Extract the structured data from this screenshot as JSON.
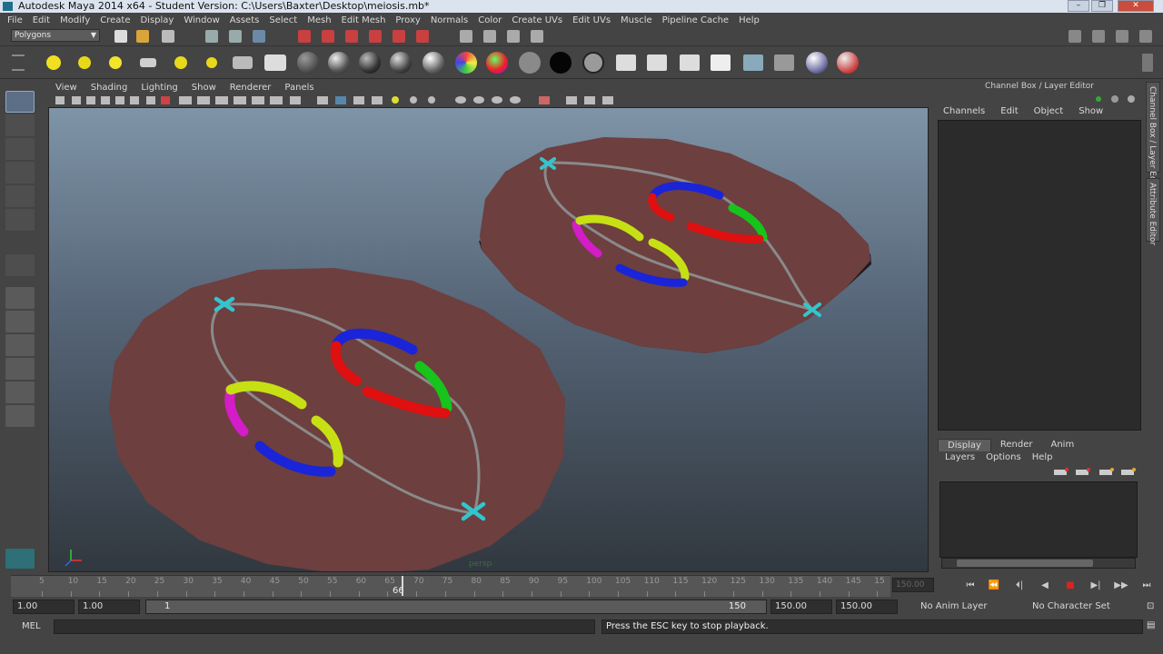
{
  "window": {
    "title": "Autodesk Maya 2014 x64 - Student Version: C:\\Users\\Baxter\\Desktop\\meiosis.mb*",
    "controls": [
      "–",
      "❐",
      "✕"
    ]
  },
  "menus": [
    "File",
    "Edit",
    "Modify",
    "Create",
    "Display",
    "Window",
    "Assets",
    "Select",
    "Mesh",
    "Edit Mesh",
    "Proxy",
    "Normals",
    "Color",
    "Create UVs",
    "Edit UVs",
    "Muscle",
    "Pipeline Cache",
    "Help"
  ],
  "statusline": {
    "mode_menu": "Polygons"
  },
  "panel": {
    "menus": [
      "View",
      "Shading",
      "Lighting",
      "Show",
      "Renderer",
      "Panels"
    ],
    "camera_label": "persp"
  },
  "colors": {
    "disc_top": "#6d3f3f",
    "disc_side": "#1a1a1f",
    "spindle": "#8a8a8a",
    "centriole": "#33c5cc",
    "red": "#e01010",
    "blue": "#1a24d8",
    "green": "#16c41c",
    "magenta": "#d41cc8",
    "yellow_green": "#c6e014"
  },
  "channel_box": {
    "title": "Channel Box / Layer Editor",
    "menus": [
      "Channels",
      "Edit",
      "Object",
      "Show"
    ],
    "side_tabs": [
      "Channel Box / Layer Editor",
      "Attribute Editor"
    ]
  },
  "layer_editor": {
    "tabs": [
      "Display",
      "Render",
      "Anim"
    ],
    "active_tab": "Display",
    "menus": [
      "Layers",
      "Options",
      "Help"
    ]
  },
  "time_slider": {
    "ticks": [
      "5",
      "10",
      "15",
      "20",
      "25",
      "30",
      "35",
      "40",
      "45",
      "50",
      "55",
      "60",
      "65",
      "70",
      "75",
      "80",
      "85",
      "90",
      "95",
      "100",
      "105",
      "110",
      "115",
      "120",
      "125",
      "130",
      "135",
      "140",
      "145",
      "15"
    ],
    "current_frame": "66",
    "current_time_field": "150.00",
    "playback_buttons": [
      "⏮",
      "⏪",
      "⏴|",
      "◀",
      "■",
      "▶|",
      "▶▶",
      "⏭"
    ]
  },
  "range": {
    "start_time": "1.00",
    "playback_start": "1.00",
    "slider_start": "1",
    "slider_end": "150",
    "playback_end": "150.00",
    "end_time": "150.00",
    "anim_layer": "No Anim Layer",
    "character_set": "No Character Set"
  },
  "command_line": {
    "label": "MEL",
    "response": "Press the ESC key to stop playback."
  }
}
